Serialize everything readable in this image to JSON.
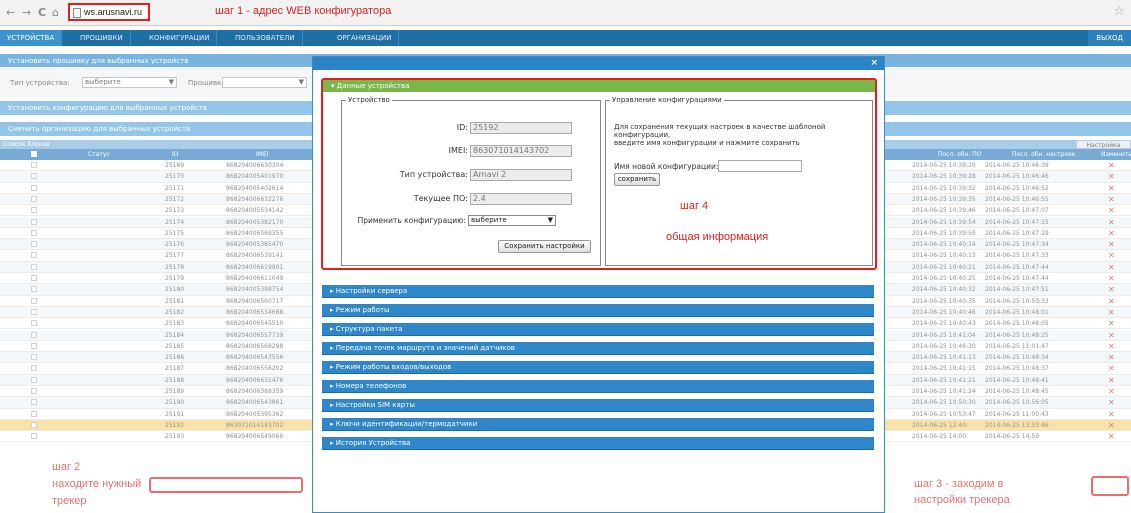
{
  "browser": {
    "url": "ws.arusnavi.ru",
    "step1": "шаг 1 - адрес WEB конфигуратора"
  },
  "menu": {
    "tabs": [
      "УСТРОЙСТВА",
      "ПРОШИВКИ",
      "КОНФИГУРАЦИИ",
      "ПОЛЬЗОВАТЕЛИ",
      "ОРГАНИЗАЦИИ"
    ],
    "exit": "ВЫХОД"
  },
  "bars": {
    "firmware": "Установить прошивку для выбранных устройств",
    "config": "Установить конфигурацию для выбранных устройств",
    "org": "Сменить организацию для выбранных устройств"
  },
  "filter": {
    "device_type_label": "Тип устройства:",
    "device_type_value": "выберите",
    "firmware_label": "Прошивка:"
  },
  "list": {
    "title": "Список блоков",
    "columns_button": "Настройка столбцов",
    "headers": {
      "status": "Статус",
      "id": "ID",
      "imei": "IMEI",
      "last_fw": "Посл. обн. ПО",
      "last_cfg": "Посл. обн. настроек",
      "edit": "Изменить"
    },
    "rows": [
      {
        "id": "25169",
        "imei": "868204006630304",
        "fw": "2014-06-25 10:39:20",
        "cfg": "2014-06-25 10:46:39"
      },
      {
        "id": "25170",
        "imei": "868204005401970",
        "fw": "2014-06-25 10:39:28",
        "cfg": "2014-06-25 10:46:46"
      },
      {
        "id": "25171",
        "imei": "868204005402614",
        "fw": "2014-06-25 10:39:32",
        "cfg": "2014-06-25 10:46:52"
      },
      {
        "id": "25172",
        "imei": "868204006632276",
        "fw": "2014-06-25 10:39:35",
        "cfg": "2014-06-25 10:46:55"
      },
      {
        "id": "25173",
        "imei": "868204005534142",
        "fw": "2014-06-25 10:39:46",
        "cfg": "2014-06-25 10:47:07"
      },
      {
        "id": "25174",
        "imei": "868204005382170",
        "fw": "2014-06-25 10:39:54",
        "cfg": "2014-06-25 10:47:15"
      },
      {
        "id": "25175",
        "imei": "868204006568355",
        "fw": "2014-06-25 10:39:59",
        "cfg": "2014-06-25 10:47:19"
      },
      {
        "id": "25176",
        "imei": "868204005385470",
        "fw": "2014-06-25 10:40:14",
        "cfg": "2014-06-25 10:47:34"
      },
      {
        "id": "25177",
        "imei": "868204006539141",
        "fw": "2014-06-25 10:40:13",
        "cfg": "2014-06-25 10:47:33"
      },
      {
        "id": "25178",
        "imei": "868204006619901",
        "fw": "2014-06-25 10:40:21",
        "cfg": "2014-06-25 10:47:44"
      },
      {
        "id": "25179",
        "imei": "868204006611049",
        "fw": "2014-06-25 10:40:25",
        "cfg": "2014-06-25 10:47:44"
      },
      {
        "id": "25180",
        "imei": "868204005398754",
        "fw": "2014-06-25 10:40:32",
        "cfg": "2014-06-25 10:47:51"
      },
      {
        "id": "25181",
        "imei": "868204006560717",
        "fw": "2014-06-25 10:40:35",
        "cfg": "2014-06-25 10:50:33"
      },
      {
        "id": "25182",
        "imei": "868204006534688",
        "fw": "2014-06-25 10:40:46",
        "cfg": "2014-06-25 10:48:01"
      },
      {
        "id": "25183",
        "imei": "868204006545510",
        "fw": "2014-06-25 10:40:43",
        "cfg": "2014-06-25 10:48:05"
      },
      {
        "id": "25184",
        "imei": "868204006557739",
        "fw": "2014-06-25 10:41:04",
        "cfg": "2014-06-25 10:48:25"
      },
      {
        "id": "25185",
        "imei": "868204006568298",
        "fw": "2014-06-25 10:46:30",
        "cfg": "2014-06-25 11:01:47"
      },
      {
        "id": "25186",
        "imei": "868204006543556",
        "fw": "2014-06-25 10:41:13",
        "cfg": "2014-06-25 10:48:34"
      },
      {
        "id": "25187",
        "imei": "868204006556202",
        "fw": "2014-06-25 10:41:15",
        "cfg": "2014-06-25 10:48:37"
      },
      {
        "id": "25188",
        "imei": "868204006631476",
        "fw": "2014-06-25 10:41:21",
        "cfg": "2014-06-25 10:48:41"
      },
      {
        "id": "25189",
        "imei": "868204006388359",
        "fw": "2014-06-25 10:41:24",
        "cfg": "2014-06-25 10:48:45"
      },
      {
        "id": "25190",
        "imei": "868204006543861",
        "fw": "2014-06-25 10:50:30",
        "cfg": "2014-06-25 10:56:05"
      },
      {
        "id": "25191",
        "imei": "868204005395362",
        "fw": "2014-06-25 10:53:47",
        "cfg": "2014-06-25 11:00:43"
      },
      {
        "id": "25192",
        "imei": "863071014143702",
        "fw": "2014-06-25 12:40:",
        "cfg": "2014-06-25 13:33:46"
      },
      {
        "id": "25193",
        "imei": "868204006549066",
        "fw": "2014-06-25 14:00:",
        "cfg": "2014-06-25 14:50"
      }
    ]
  },
  "modal": {
    "section": "Данные устройства",
    "device_legend": "Устройство",
    "id_label": "ID:",
    "id_value": "25192",
    "imei_label": "IMEI:",
    "imei_value": "863071014143702",
    "type_label": "Тип устройства:",
    "type_value": "Arnavi 2",
    "fw_label": "Текущее ПО:",
    "fw_value": "2.4",
    "apply_label": "Применить конфигурацию:",
    "apply_value": "выберите",
    "save_button": "Сохранить настройки",
    "cfg_legend": "Управление конфигурациями",
    "cfg_text_1": "Для сохранения текущих настроек в качестве шаблоной",
    "cfg_text_2": "конфигурации,",
    "cfg_text_3": "введите имя конфигурации и нажмите сохранить",
    "new_cfg_label": "Имя новой конфигурации:",
    "save_cfg_button": "сохранить",
    "accordion": [
      "Настройки сервера",
      "Режим работы",
      "Структура пакета",
      "Передача точек маршрута и значений датчиков",
      "Режим работы входов/выходов",
      "Номера телефонов",
      "Настройки SIM карты",
      "Ключи идентификации/термодатчики",
      "История Устройства"
    ]
  },
  "annotations": {
    "step2_a": "шаг 2",
    "step2_b": "находите нужный",
    "step2_c": "трекер",
    "step3_a": "шаг 3 - заходим в",
    "step3_b": "настройки трекера",
    "step4_a": "шаг 4",
    "step4_b": "общая информация"
  }
}
